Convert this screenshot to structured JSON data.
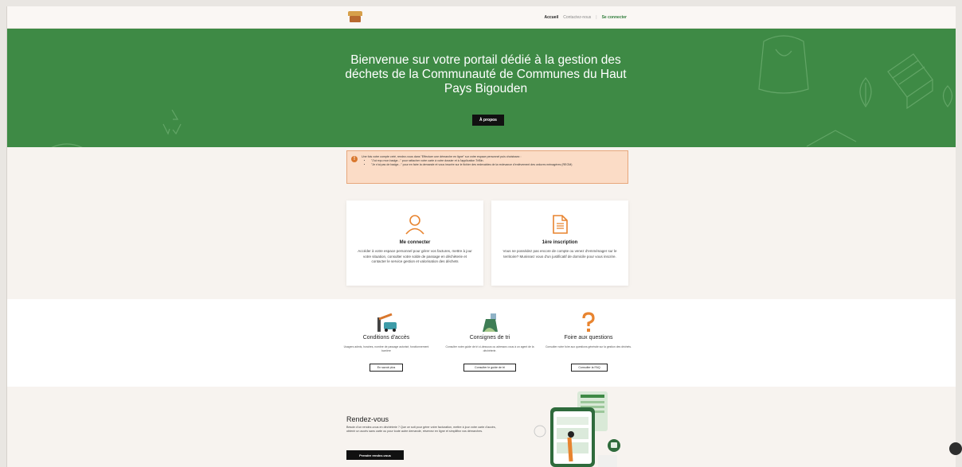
{
  "header": {
    "nav": {
      "home": "Accueil",
      "contact": "Contactez-nous",
      "login": "Se connecter"
    }
  },
  "hero": {
    "title": "Bienvenue sur votre portail dédié à la gestion des déchets de la Communauté de Communes du Haut Pays Bigouden",
    "button": "À propos"
  },
  "notice": {
    "intro": "Une fois votre compte créé, rendez-vous dans \"Effectuer une démarche en ligne\" sur votre espace personnel puis choisissez :",
    "items": [
      "\"J'ai reçu mon badge...\" pour rattacher votre carte à votre dossier et à l'application TriBin.",
      "\"Je n'ai pas de badge...\" pour en faire la demande et vous inscrire sur le fichier des redevables de la redevance d'enlèvement des ordures ménagères (REOM)"
    ]
  },
  "cards": [
    {
      "title": "Me connecter",
      "text": "Accéder à votre espace personnel pour gérer vos factures, mettre à jour votre situation, consulter votre solde de passage en déchèterie et contacter le service gestion et valorisation des déchets",
      "icon": "user-icon"
    },
    {
      "title": "1ère inscription",
      "text": "Vous ne possédez pas encore de compte ou venez d'emménager sur le territoire? Munissez vous d'un justificatif de domicile pour vous inscrire.",
      "icon": "document-icon"
    }
  ],
  "info": [
    {
      "title": "Conditions d'accès",
      "text": "Usagers admis, horaires, nombre de passage autorisé, fonctionnement barrière",
      "button": "En savoir plus",
      "icon": "barrier-car-icon"
    },
    {
      "title": "Consignes de tri",
      "text": "Consulter notre guide de tri ci-dessous ou adressez-vous à un agent de la déchèterie.",
      "button": "Consulter le guide de tri",
      "icon": "bin-icon"
    },
    {
      "title": "Foire aux questions",
      "text": "Consulter notre foire aux questions générale sur la gestion des déchets.",
      "button": "Consulter la FAQ",
      "icon": "question-icon"
    }
  ],
  "rdv": {
    "title": "Rendez-vous",
    "text": "Besoin d'un rendez-vous en déchèterie ? Que ce soit pour gérer votre facturation, mettre à jour votre carte d'accès, obtenir un accès sans carte ou pour toute autre demande, réservez en ligne et simplifiez vos démarches.",
    "button": "Prendre rendez-vous"
  },
  "colors": {
    "hero": "#3e8a45",
    "accent": "#e8842f",
    "notice": "#fbdcc6"
  }
}
